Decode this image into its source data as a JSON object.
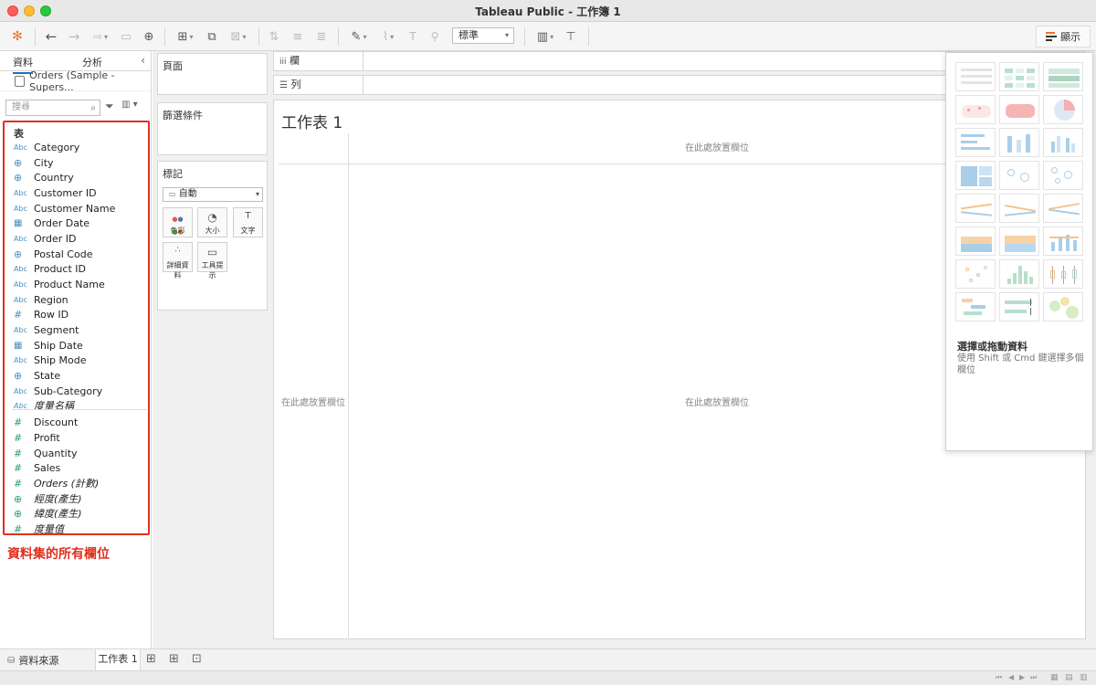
{
  "window": {
    "title": "Tableau Public - 工作簿 1"
  },
  "toolbar": {
    "standard_select": "標準",
    "show_me_label": "顯示"
  },
  "data_pane": {
    "tabs": [
      {
        "label": "資料"
      },
      {
        "label": "分析"
      }
    ],
    "datasource": "Orders (Sample - Supers...",
    "search_placeholder": "搜尋",
    "group_title": "表",
    "dimensions": [
      {
        "icon": "Abc",
        "name": "Category"
      },
      {
        "icon": "globe",
        "name": "City"
      },
      {
        "icon": "globe",
        "name": "Country"
      },
      {
        "icon": "Abc",
        "name": "Customer ID"
      },
      {
        "icon": "Abc",
        "name": "Customer Name"
      },
      {
        "icon": "calendar",
        "name": "Order Date"
      },
      {
        "icon": "Abc",
        "name": "Order ID"
      },
      {
        "icon": "globe",
        "name": "Postal Code"
      },
      {
        "icon": "Abc",
        "name": "Product ID"
      },
      {
        "icon": "Abc",
        "name": "Product Name"
      },
      {
        "icon": "Abc",
        "name": "Region"
      },
      {
        "icon": "hash",
        "name": "Row ID"
      },
      {
        "icon": "Abc",
        "name": "Segment"
      },
      {
        "icon": "calendar",
        "name": "Ship Date"
      },
      {
        "icon": "Abc",
        "name": "Ship Mode"
      },
      {
        "icon": "globe",
        "name": "State"
      },
      {
        "icon": "Abc",
        "name": "Sub-Category"
      },
      {
        "icon": "Abc",
        "name": "度量名稱"
      }
    ],
    "measures": [
      {
        "icon": "hash",
        "name": "Discount"
      },
      {
        "icon": "hash",
        "name": "Profit"
      },
      {
        "icon": "hash",
        "name": "Quantity"
      },
      {
        "icon": "hash",
        "name": "Sales"
      },
      {
        "icon": "hash",
        "name": "Orders (計數)"
      },
      {
        "icon": "globe",
        "name": "經度(產生)"
      },
      {
        "icon": "globe",
        "name": "緯度(產生)"
      },
      {
        "icon": "hash",
        "name": "度量值"
      }
    ],
    "annotation": "資料集的所有欄位"
  },
  "shelves": {
    "pages": "頁面",
    "filters": "篩選條件",
    "marks": "標記",
    "mark_type": "自動",
    "mark_buttons": [
      {
        "label": "色彩"
      },
      {
        "label": "大小"
      },
      {
        "label": "文字"
      },
      {
        "label": "詳細資料"
      },
      {
        "label": "工具提示"
      }
    ]
  },
  "workspace": {
    "columns_label": "欄",
    "rows_label": "列",
    "sheet_title": "工作表 1",
    "drop_field_text": "在此處放置欄位"
  },
  "show_me": {
    "title": "選擇或拖動資料",
    "description": "使用 Shift 或 Cmd 鍵選擇多個欄位"
  },
  "bottom": {
    "data_source_tab": "資料來源",
    "sheet_tab": "工作表 1"
  },
  "colors": {
    "annotation_red": "#e0301e",
    "dimension_blue": "#4a90c2",
    "measure_green": "#2f9e68"
  }
}
